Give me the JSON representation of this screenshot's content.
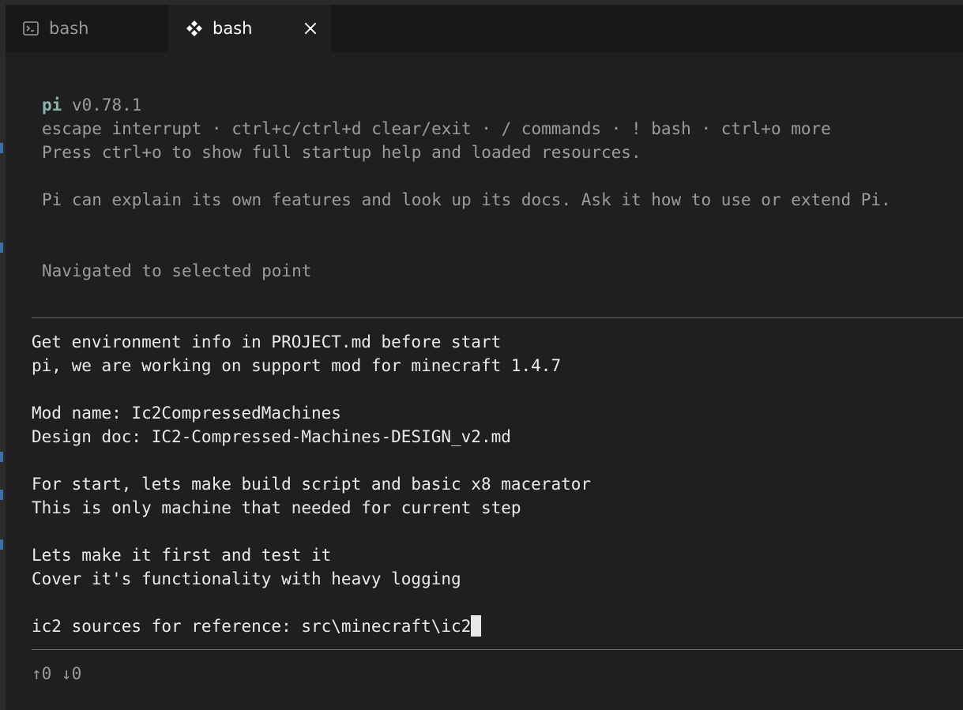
{
  "tabs": [
    {
      "label": "bash",
      "icon": "terminal-icon",
      "active": false
    },
    {
      "label": "bash",
      "icon": "diamond-icon",
      "active": true,
      "close_icon": "close-icon"
    }
  ],
  "header": {
    "brand": "pi",
    "version": "v0.78.1",
    "hints": "escape interrupt · ctrl+c/ctrl+d clear/exit · / commands · ! bash · ctrl+o more",
    "startup_help": "Press ctrl+o to show full startup help and loaded resources.",
    "explain": "Pi can explain its own features and look up its docs. Ask it how to use or extend Pi.",
    "status": "Navigated to selected point"
  },
  "prompt": {
    "lines": [
      "Get environment info in PROJECT.md before start",
      "pi, we are working on support mod for minecraft 1.4.7",
      "",
      "Mod name: Ic2CompressedMachines",
      "Design doc: IC2-Compressed-Machines-DESIGN_v2.md",
      "",
      "For start, lets make build script and basic x8 macerator",
      "This is only machine that needed for current step",
      "",
      "Lets make it first and test it",
      "Cover it's functionality with heavy logging",
      "",
      "ic2 sources for reference: src\\minecraft\\ic2"
    ]
  },
  "footer": {
    "history": "↑0 ↓0"
  },
  "colors": {
    "background": "#1f1f1f",
    "tabbar": "#181818",
    "text": "#ebebeb",
    "dim_text": "#9c9c9c",
    "brand": "#8ab4ae",
    "rule": "#6a6a6a",
    "gutter_mark": "#3d6fa8"
  }
}
